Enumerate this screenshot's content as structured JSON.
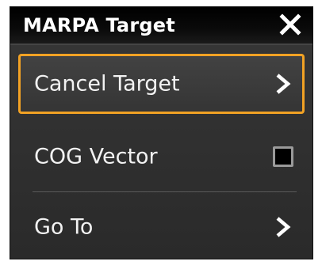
{
  "dialog": {
    "title": "MARPA Target",
    "close_icon": "close-x-icon",
    "accent_color": "#f2a224",
    "items": [
      {
        "label": "Cancel Target",
        "control": "chevron-right-icon",
        "selected": true
      },
      {
        "label": "COG Vector",
        "control": "checkbox",
        "checked": false
      },
      {
        "label": "Go To",
        "control": "chevron-right-icon",
        "selected": false
      }
    ]
  }
}
